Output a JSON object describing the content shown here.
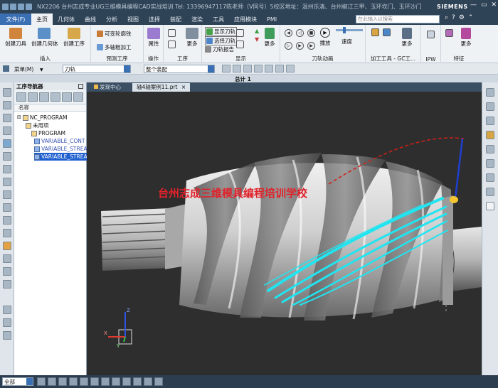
{
  "titlebar": {
    "text": "NX2206 台州志成专业UG三维模具编程CAD实战培训  Tel: 13396947117陈老师（V同号）5校区地址：温州乐清、台州椒江三甲、玉环坎门、玉环沙门、玉环坎门 - 加工",
    "brand": "SIEMENS"
  },
  "menubar": {
    "file": "文件(F)",
    "tabs": [
      "主页",
      "几何体",
      "曲线",
      "分析",
      "视图",
      "选择",
      "装配",
      "渲染",
      "工具",
      "应用模块",
      "PMI"
    ],
    "active_tab": "主页",
    "search_placeholder": "在此输入以搜索"
  },
  "ribbon": {
    "group_insert": {
      "label": "插入",
      "buttons": [
        "创建刀具",
        "创建几何体",
        "创建工序"
      ]
    },
    "group_predefined": {
      "label": "预测工序",
      "items": [
        "可变轮廓铣",
        "多轴粗加工"
      ]
    },
    "group_operation": {
      "label": "操作",
      "button": "属性"
    },
    "group_process": {
      "label": "工序",
      "more": "更多"
    },
    "group_display": {
      "label": "显示",
      "items": [
        "显示刀轨",
        "选择刀轨",
        "刀轨报告"
      ],
      "more": "更多"
    },
    "group_animation": {
      "label": "刀轨动画",
      "play": "播放",
      "speed": "速度"
    },
    "group_tools": {
      "label": "加工工具 - GC工...",
      "more": "更多"
    },
    "group_ipw": {
      "label": "IPW"
    },
    "group_feature": {
      "label": "特征",
      "more": "更多"
    }
  },
  "filterbar": {
    "menu_label": "菜单(M)",
    "filter_value": "刀轨",
    "assembly_value": "整个装配"
  },
  "partbar": {
    "title": "总计 1"
  },
  "navigator": {
    "title": "工序导航器",
    "column": "名称",
    "tree": [
      {
        "label": "NC_PROGRAM",
        "level": 0,
        "type": "root"
      },
      {
        "label": "未用项",
        "level": 1,
        "type": "folder"
      },
      {
        "label": "PROGRAM",
        "level": 1,
        "type": "folder"
      },
      {
        "label": "VARIABLE_CONT",
        "level": 1,
        "type": "op"
      },
      {
        "label": "VARIABLE_STREA",
        "level": 1,
        "type": "op"
      },
      {
        "label": "VARIABLE_STREA",
        "level": 1,
        "type": "op-selected"
      }
    ]
  },
  "tabs": {
    "tab1": "发现中心",
    "tab2": "轴4轴案例11.prt",
    "tab2_close": "×"
  },
  "viewport": {
    "watermark": "台州志成三维模具编程培训学校",
    "axis_labels": {
      "x": "X",
      "y": "Y",
      "z": "Z"
    },
    "toolpath_color": "#20e5f0",
    "rapid_color": "#d0201a",
    "watermark_color": "#e0222a"
  },
  "statusbar": {
    "select_value": "全部"
  }
}
